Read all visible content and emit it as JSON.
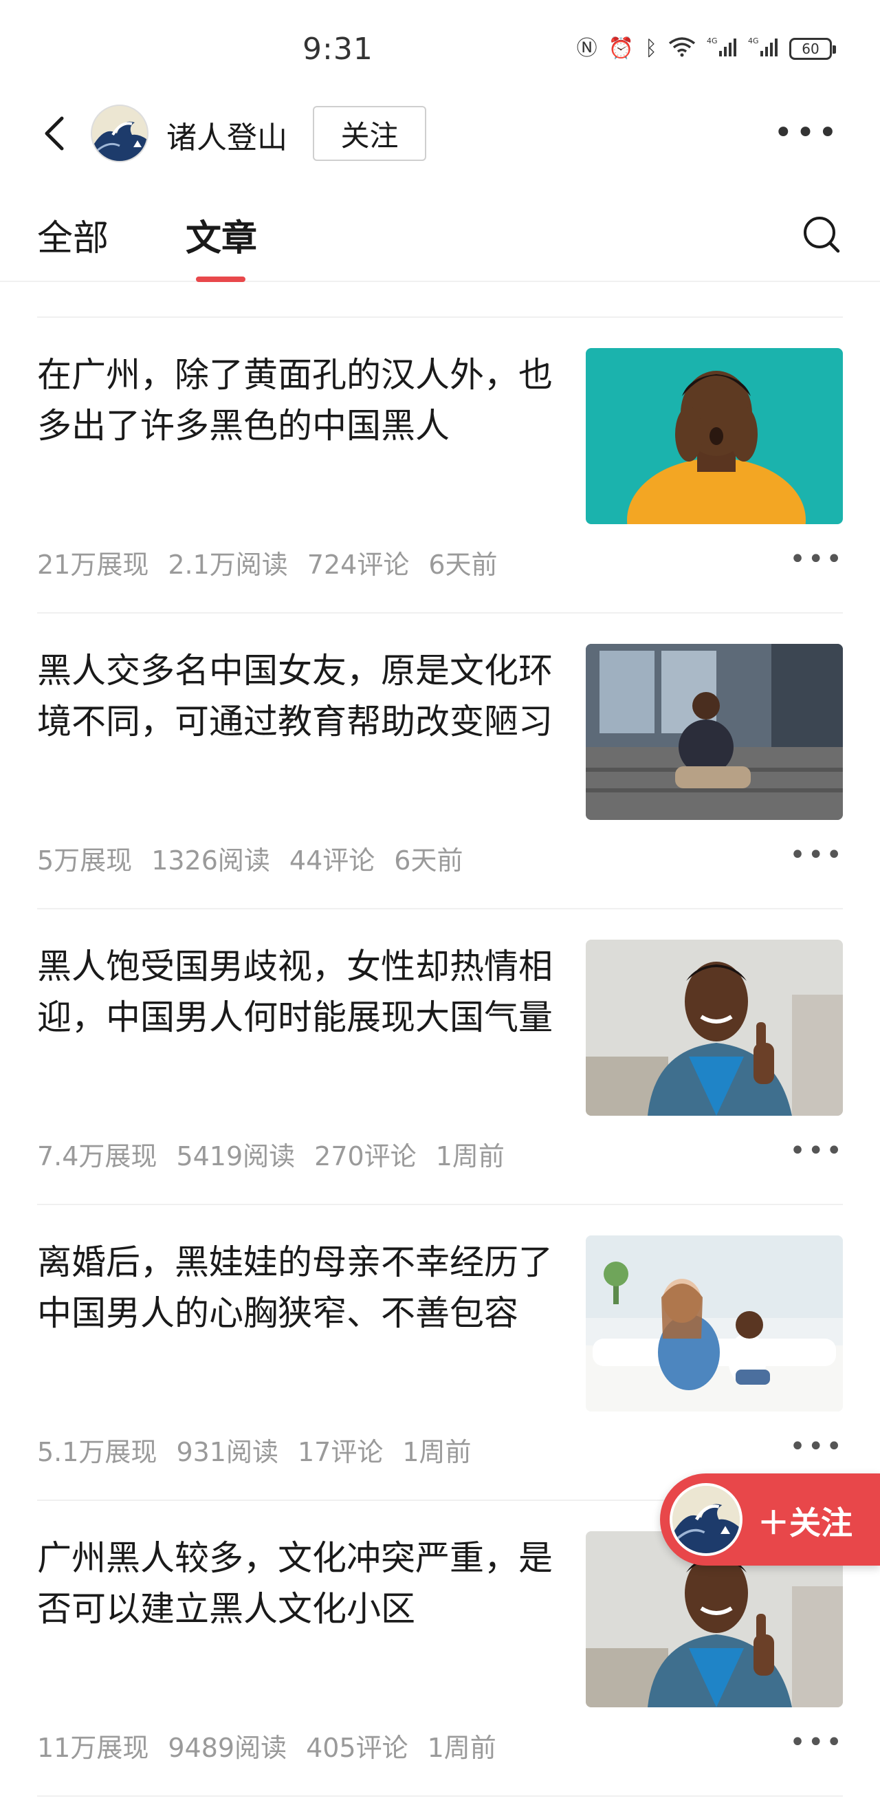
{
  "status_bar": {
    "time": "9:31",
    "icons": [
      "nfc-icon",
      "alarm-icon",
      "bluetooth-icon",
      "wifi-icon",
      "signal-4g-icon",
      "signal-4g-icon-2"
    ],
    "battery": "60"
  },
  "header": {
    "author_name": "诸人登山",
    "follow_label": "关注"
  },
  "tabs": [
    {
      "label": "全部",
      "active": false
    },
    {
      "label": "文章",
      "active": true
    }
  ],
  "articles": [
    {
      "title": "在广州，除了黄面孔的汉人外，也多出了许多黑色的中国黑人",
      "impressions": "21万展现",
      "reads": "2.1万阅读",
      "comments": "724评论",
      "time": "6天前"
    },
    {
      "title": "黑人交多名中国女友，原是文化环境不同，可通过教育帮助改变陋习",
      "impressions": "5万展现",
      "reads": "1326阅读",
      "comments": "44评论",
      "time": "6天前"
    },
    {
      "title": "黑人饱受国男歧视，女性却热情相迎，中国男人何时能展现大国气量",
      "impressions": "7.4万展现",
      "reads": "5419阅读",
      "comments": "270评论",
      "time": "1周前"
    },
    {
      "title": "离婚后，黑娃娃的母亲不幸经历了中国男人的心胸狭窄、不善包容",
      "impressions": "5.1万展现",
      "reads": "931阅读",
      "comments": "17评论",
      "time": "1周前"
    },
    {
      "title": "广州黑人较多，文化冲突严重，是否可以建立黑人文化小区",
      "impressions": "11万展现",
      "reads": "9489阅读",
      "comments": "405评论",
      "time": "1周前"
    }
  ],
  "floating_follow": {
    "label": "＋关注"
  },
  "colors": {
    "accent": "#e8484b",
    "meta_text": "#9a9a9a"
  }
}
